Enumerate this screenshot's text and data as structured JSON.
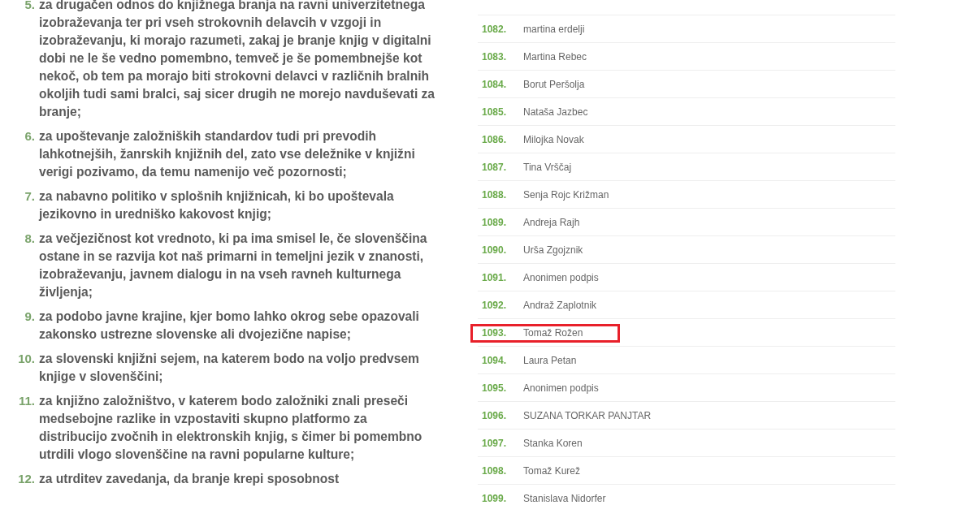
{
  "demands": [
    {
      "number": "5.",
      "text": "za drugačen odnos do knjižnega branja na ravni univerzitetnega izobraževanja ter pri vseh strokovnih delavcih v vzgoji in izobraževanju, ki morajo razumeti, zakaj je branje knjig v digitalni dobi ne le še vedno pomembno, temveč je še pomembnejše kot nekoč, ob tem pa morajo biti strokovni delavci v različnih bralnih okoljih tudi sami bralci, saj sicer drugih ne morejo navduševati za branje;"
    },
    {
      "number": "6.",
      "text": "za upoštevanje založniških standardov tudi pri prevodih lahkotnejših, žanrskih knjižnih del, zato vse deležnike v knjižni verigi pozivamo, da temu namenijo več pozornosti;"
    },
    {
      "number": "7.",
      "text": "za nabavno politiko v splošnih knjižnicah, ki bo upoštevala jezikovno in uredniško kakovost knjig;"
    },
    {
      "number": "8.",
      "text": "za večjezičnost kot vrednoto, ki pa ima smisel le, če slovenščina ostane in se razvija kot naš primarni in temeljni jezik v znanosti, izobraževanju, javnem dialogu in na vseh ravneh kulturnega življenja;"
    },
    {
      "number": "9.",
      "text": "za podobo javne krajine, kjer bomo lahko okrog sebe opazovali zakonsko ustrezne slovenske ali dvojezične napise;"
    },
    {
      "number": "10.",
      "text": "za slovenski knjižni sejem, na katerem bodo na voljo predvsem knjige v slovenščini;"
    },
    {
      "number": "11.",
      "text": "za knjižno založništvo, v katerem bodo založniki znali preseči medsebojne razlike in vzpostaviti skupno platformo za distribucijo zvočnih in elektronskih knjig, s čimer bi pomembno utrdili vlogo slovenščine na ravni popularne kulture;"
    },
    {
      "number": "12.",
      "text": "za utrditev zavedanja, da branje krepi sposobnost"
    }
  ],
  "signatures": [
    {
      "number": "1082.",
      "name": "martina erdelji",
      "highlighted": false
    },
    {
      "number": "1083.",
      "name": "Martina Rebec",
      "highlighted": false
    },
    {
      "number": "1084.",
      "name": "Borut Peršolja",
      "highlighted": false
    },
    {
      "number": "1085.",
      "name": "Nataša Jazbec",
      "highlighted": false
    },
    {
      "number": "1086.",
      "name": "Milojka Novak",
      "highlighted": false
    },
    {
      "number": "1087.",
      "name": "Tina Vrščaj",
      "highlighted": false
    },
    {
      "number": "1088.",
      "name": "Senja Rojc Križman",
      "highlighted": false
    },
    {
      "number": "1089.",
      "name": "Andreja Rajh",
      "highlighted": false
    },
    {
      "number": "1090.",
      "name": "Urša Zgojznik",
      "highlighted": false
    },
    {
      "number": "1091.",
      "name": "Anonimen podpis",
      "highlighted": false
    },
    {
      "number": "1092.",
      "name": "Andraž Zaplotnik",
      "highlighted": false
    },
    {
      "number": "1093.",
      "name": "Tomaž Rožen",
      "highlighted": true
    },
    {
      "number": "1094.",
      "name": "Laura Petan",
      "highlighted": false
    },
    {
      "number": "1095.",
      "name": "Anonimen podpis",
      "highlighted": false
    },
    {
      "number": "1096.",
      "name": "SUZANA TORKAR PANJTAR",
      "highlighted": false
    },
    {
      "number": "1097.",
      "name": "Stanka Koren",
      "highlighted": false
    },
    {
      "number": "1098.",
      "name": "Tomaž Kurež",
      "highlighted": false
    },
    {
      "number": "1099.",
      "name": "Stanislava Nidorfer",
      "highlighted": false
    }
  ]
}
